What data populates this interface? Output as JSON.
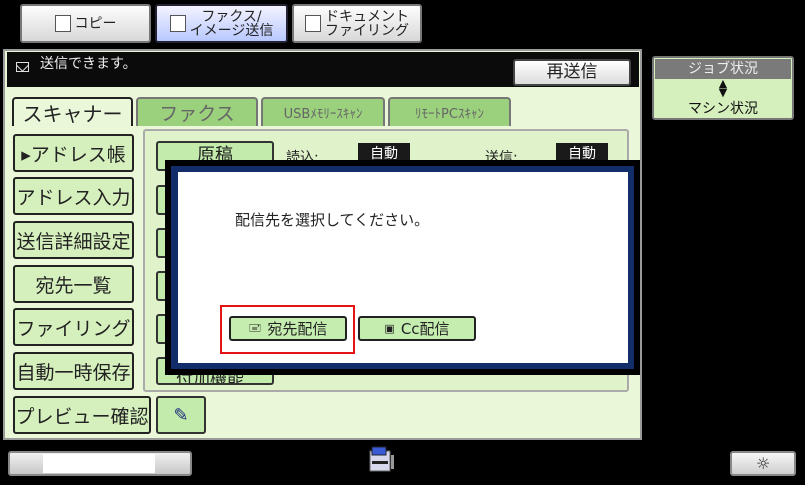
{
  "mode_tabs": [
    {
      "line1": "コピー",
      "line2": ""
    },
    {
      "line1": "ファクス/",
      "line2": "イメージ送信"
    },
    {
      "line1": "ドキュメント",
      "line2": "ファイリング"
    }
  ],
  "status": {
    "message": "送信できます。"
  },
  "resend_label": "再送信",
  "sub_tabs": [
    "スキャナー",
    "ファクス",
    "USBﾒﾓﾘｰｽｷｬﾝ",
    "ﾘﾓｰﾄPCｽｷｬﾝ"
  ],
  "left_buttons": [
    "▸アドレス帳",
    "アドレス入力",
    "送信詳細設定",
    "宛先一覧",
    "ファイリング",
    "自動一時保存",
    "プレビュー確認"
  ],
  "settings": {
    "original_label": "原稿",
    "read_label": "読込:",
    "read_value": "自動",
    "send_label": "送信:",
    "send_value": "自動",
    "other_functions_label": "付加機能"
  },
  "dialog": {
    "message": "配信先を選択してください。",
    "to_button": "宛先配信",
    "cc_button": "Cc配信"
  },
  "job_status": {
    "top": "ジョブ状況",
    "bottom": "マシン状況"
  },
  "colors": {
    "panel_bg": "#eaf7d9",
    "button_green": "#c3ecac",
    "dialog_border": "#122d6a",
    "highlight": "#e31313"
  }
}
